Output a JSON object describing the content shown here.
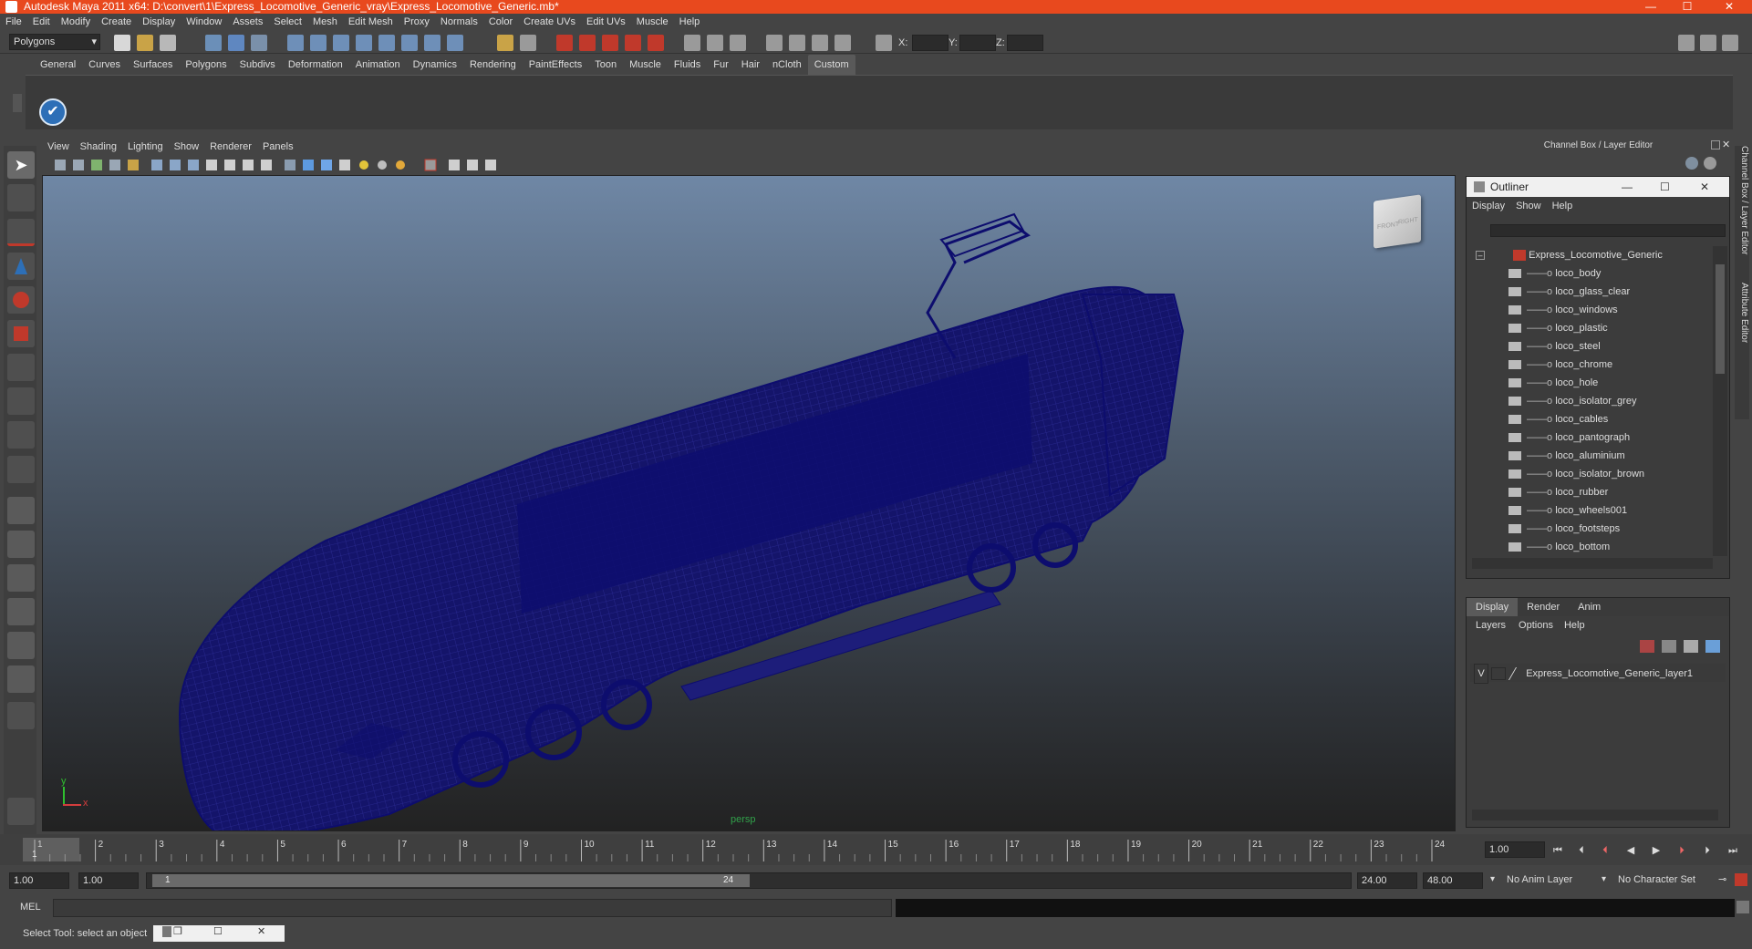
{
  "window": {
    "title": "Autodesk Maya 2011 x64: D:\\convert\\1\\Express_Locomotive_Generic_vray\\Express_Locomotive_Generic.mb*",
    "controls": [
      "—",
      "☐",
      "✕"
    ]
  },
  "menubar": [
    "File",
    "Edit",
    "Modify",
    "Create",
    "Display",
    "Window",
    "Assets",
    "Select",
    "Mesh",
    "Edit Mesh",
    "Proxy",
    "Normals",
    "Color",
    "Create UVs",
    "Edit UVs",
    "Muscle",
    "Help"
  ],
  "statusline": {
    "mode": "Polygons",
    "x_label": "X:",
    "y_label": "Y:",
    "z_label": "Z:"
  },
  "shelf": {
    "tabs": [
      "General",
      "Curves",
      "Surfaces",
      "Polygons",
      "Subdivs",
      "Deformation",
      "Animation",
      "Dynamics",
      "Rendering",
      "PaintEffects",
      "Toon",
      "Muscle",
      "Fluids",
      "Fur",
      "Hair",
      "nCloth",
      "Custom"
    ],
    "active_tab": "Custom"
  },
  "viewport": {
    "menus": [
      "View",
      "Shading",
      "Lighting",
      "Show",
      "Renderer",
      "Panels"
    ],
    "camera_label": "persp",
    "viewcube": {
      "front": "FRONT",
      "right": "RIGHT"
    },
    "axis_y": "y",
    "axis_x": "x"
  },
  "right_panel": {
    "header": "Channel Box / Layer Editor",
    "side_tabs": [
      "Channel Box / Layer Editor",
      "Attribute Editor"
    ]
  },
  "outliner": {
    "title": "Outliner",
    "menus": [
      "Display",
      "Show",
      "Help"
    ],
    "root": "Express_Locomotive_Generic",
    "children": [
      "loco_body",
      "loco_glass_clear",
      "loco_windows",
      "loco_plastic",
      "loco_steel",
      "loco_chrome",
      "loco_hole",
      "loco_isolator_grey",
      "loco_cables",
      "loco_pantograph",
      "loco_aluminium",
      "loco_isolator_brown",
      "loco_rubber",
      "loco_wheels001",
      "loco_footsteps",
      "loco_bottom"
    ]
  },
  "layer_editor": {
    "tabs": [
      "Display",
      "Render",
      "Anim"
    ],
    "active_tab": "Display",
    "menus": [
      "Layers",
      "Options",
      "Help"
    ],
    "layer_visibility": "V",
    "layer_name": "Express_Locomotive_Generic_layer1"
  },
  "timeline": {
    "ticks": [
      "1",
      "2",
      "3",
      "4",
      "5",
      "6",
      "7",
      "8",
      "9",
      "10",
      "11",
      "12",
      "13",
      "14",
      "15",
      "16",
      "17",
      "18",
      "19",
      "20",
      "21",
      "22",
      "23",
      "24"
    ],
    "current_frame_marker": "1",
    "current_time": "1.00"
  },
  "range": {
    "start_time": "1.00",
    "playback_start": "1.00",
    "range_start_label": "1",
    "range_end_label": "24",
    "playback_end": "24.00",
    "end_time": "48.00",
    "anim_layer": "No Anim Layer",
    "character_set": "No Character Set"
  },
  "cmdline": {
    "label": "MEL"
  },
  "helpline": {
    "text": "Select Tool: select an object"
  },
  "colors": {
    "titlebar": "#e8491e",
    "wireframe": "#0d0d6e",
    "persp_label": "#31a14a",
    "background": "#444444"
  }
}
